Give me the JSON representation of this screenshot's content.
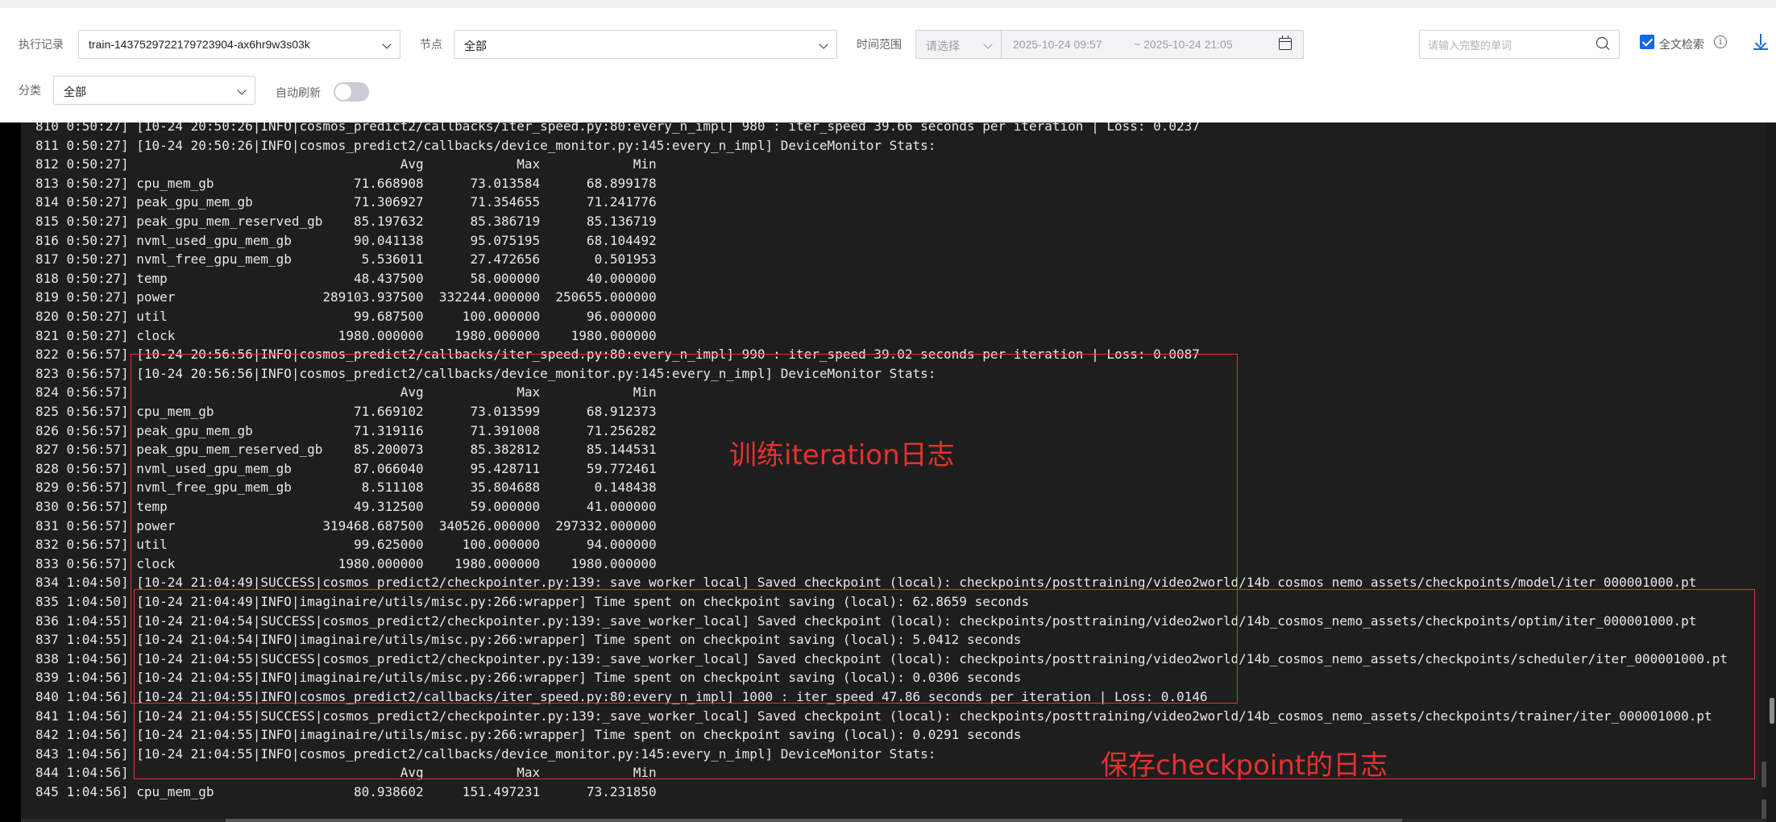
{
  "filters": {
    "exec_label": "执行记录",
    "exec_value": "train-1437529722179723904-ax6hr9w3s03k",
    "node_label": "节点",
    "node_value": "全部",
    "time_label": "时间范围",
    "time_select_placeholder": "请选择",
    "date_start": "2025-10-24 09:57",
    "date_end": "~ 2025-10-24 21:05",
    "search_placeholder": "请输入完整的单词",
    "fulltext_label": "全文检索",
    "category_label": "分类",
    "category_value": "全部",
    "autorefresh_label": "自动刷新",
    "autorefresh_on": false
  },
  "log_lines": [
    "810 0:50:27] [10-24 20:50:26|INFO|cosmos_predict2/callbacks/iter_speed.py:80:every_n_impl] 980 : iter_speed 39.66 seconds per iteration | Loss: 0.0237",
    "811 0:50:27] [10-24 20:50:26|INFO|cosmos_predict2/callbacks/device_monitor.py:145:every_n_impl] DeviceMonitor Stats:",
    "812 0:50:27]                                   Avg            Max            Min",
    "813 0:50:27] cpu_mem_gb                  71.668908      73.013584      68.899178",
    "814 0:50:27] peak_gpu_mem_gb             71.306927      71.354655      71.241776",
    "815 0:50:27] peak_gpu_mem_reserved_gb    85.197632      85.386719      85.136719",
    "816 0:50:27] nvml_used_gpu_mem_gb        90.041138      95.075195      68.104492",
    "817 0:50:27] nvml_free_gpu_mem_gb         5.536011      27.472656       0.501953",
    "818 0:50:27] temp                        48.437500      58.000000      40.000000",
    "819 0:50:27] power                   289103.937500  332244.000000  250655.000000",
    "820 0:50:27] util                        99.687500     100.000000      96.000000",
    "821 0:50:27] clock                     1980.000000    1980.000000    1980.000000",
    "822 0:56:57] [10-24 20:56:56|INFO|cosmos_predict2/callbacks/iter_speed.py:80:every_n_impl] 990 : iter_speed 39.02 seconds per iteration | Loss: 0.0087",
    "823 0:56:57] [10-24 20:56:56|INFO|cosmos_predict2/callbacks/device_monitor.py:145:every_n_impl] DeviceMonitor Stats:",
    "824 0:56:57]                                   Avg            Max            Min",
    "825 0:56:57] cpu_mem_gb                  71.669102      73.013599      68.912373",
    "826 0:56:57] peak_gpu_mem_gb             71.319116      71.391008      71.256282",
    "827 0:56:57] peak_gpu_mem_reserved_gb    85.200073      85.382812      85.144531",
    "828 0:56:57] nvml_used_gpu_mem_gb        87.066040      95.428711      59.772461",
    "829 0:56:57] nvml_free_gpu_mem_gb         8.511108      35.804688       0.148438",
    "830 0:56:57] temp                        49.312500      59.000000      41.000000",
    "831 0:56:57] power                   319468.687500  340526.000000  297332.000000",
    "832 0:56:57] util                        99.625000     100.000000      94.000000",
    "833 0:56:57] clock                     1980.000000    1980.000000    1980.000000",
    "834 1:04:50] [10-24 21:04:49|SUCCESS|cosmos_predict2/checkpointer.py:139:_save_worker_local] Saved checkpoint (local): checkpoints/posttraining/video2world/14b_cosmos_nemo_assets/checkpoints/model/iter_000001000.pt",
    "835 1:04:50] [10-24 21:04:49|INFO|imaginaire/utils/misc.py:266:wrapper] Time spent on checkpoint saving (local): 62.8659 seconds",
    "836 1:04:55] [10-24 21:04:54|SUCCESS|cosmos_predict2/checkpointer.py:139:_save_worker_local] Saved checkpoint (local): checkpoints/posttraining/video2world/14b_cosmos_nemo_assets/checkpoints/optim/iter_000001000.pt",
    "837 1:04:55] [10-24 21:04:54|INFO|imaginaire/utils/misc.py:266:wrapper] Time spent on checkpoint saving (local): 5.0412 seconds",
    "838 1:04:56] [10-24 21:04:55|SUCCESS|cosmos_predict2/checkpointer.py:139:_save_worker_local] Saved checkpoint (local): checkpoints/posttraining/video2world/14b_cosmos_nemo_assets/checkpoints/scheduler/iter_000001000.pt",
    "839 1:04:56] [10-24 21:04:55|INFO|imaginaire/utils/misc.py:266:wrapper] Time spent on checkpoint saving (local): 0.0306 seconds",
    "840 1:04:56] [10-24 21:04:55|INFO|cosmos_predict2/callbacks/iter_speed.py:80:every_n_impl] 1000 : iter_speed 47.86 seconds per iteration | Loss: 0.0146",
    "841 1:04:56] [10-24 21:04:55|SUCCESS|cosmos_predict2/checkpointer.py:139:_save_worker_local] Saved checkpoint (local): checkpoints/posttraining/video2world/14b_cosmos_nemo_assets/checkpoints/trainer/iter_000001000.pt",
    "842 1:04:56] [10-24 21:04:55|INFO|imaginaire/utils/misc.py:266:wrapper] Time spent on checkpoint saving (local): 0.0291 seconds",
    "843 1:04:56] [10-24 21:04:55|INFO|cosmos_predict2/callbacks/device_monitor.py:145:every_n_impl] DeviceMonitor Stats:",
    "844 1:04:56]                                   Avg            Max            Min",
    "845 1:04:56] cpu_mem_gb                  80.938602     151.497231      73.231850"
  ],
  "annotations": {
    "iteration_note": "训练iteration日志",
    "checkpoint_note": "保存checkpoint的日志",
    "color": "#e83030"
  },
  "colors": {
    "accent": "#1669e0",
    "console_bg": "#1e1e1e",
    "console_text": "#e8e8e8"
  },
  "icons": {
    "dropdown": "chevron-down-icon",
    "calendar": "calendar-icon",
    "search": "search-icon",
    "info": "info-icon",
    "download": "download-icon",
    "scroll_top": "arrow-up-icon",
    "scroll_bottom": "arrow-down-icon"
  }
}
